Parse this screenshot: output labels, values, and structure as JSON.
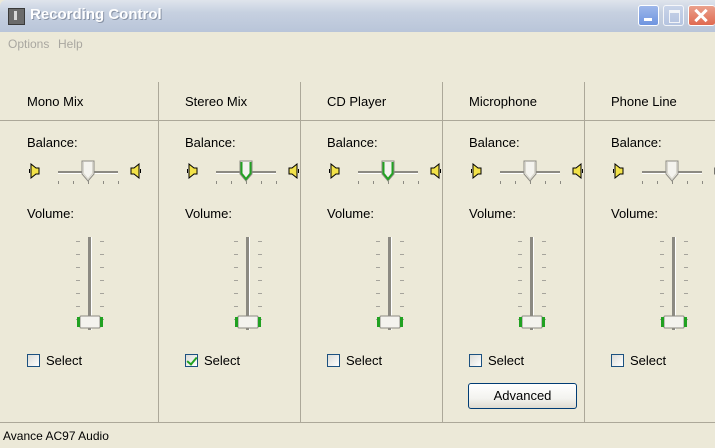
{
  "window": {
    "title": "Recording Control"
  },
  "menu": {
    "options": "Options",
    "help": "Help"
  },
  "labels": {
    "balance": "Balance:",
    "volume": "Volume:",
    "select": "Select"
  },
  "channels": [
    {
      "name": "Mono Mix",
      "balance": 0.5,
      "volume": 0.0,
      "selected": false,
      "active": false
    },
    {
      "name": "Stereo Mix",
      "balance": 0.5,
      "volume": 0.0,
      "selected": true,
      "active": true
    },
    {
      "name": "CD Player",
      "balance": 0.5,
      "volume": 0.0,
      "selected": false,
      "active": true
    },
    {
      "name": "Microphone",
      "balance": 0.5,
      "volume": 0.0,
      "selected": false,
      "active": false,
      "advanced": "Advanced"
    },
    {
      "name": "Phone Line",
      "balance": 0.5,
      "volume": 0.0,
      "selected": false,
      "active": false
    }
  ],
  "status": {
    "device": "Avance AC97 Audio"
  },
  "colors": {
    "accent_green": "#21a121",
    "titlebar": "#c6d0e0"
  }
}
